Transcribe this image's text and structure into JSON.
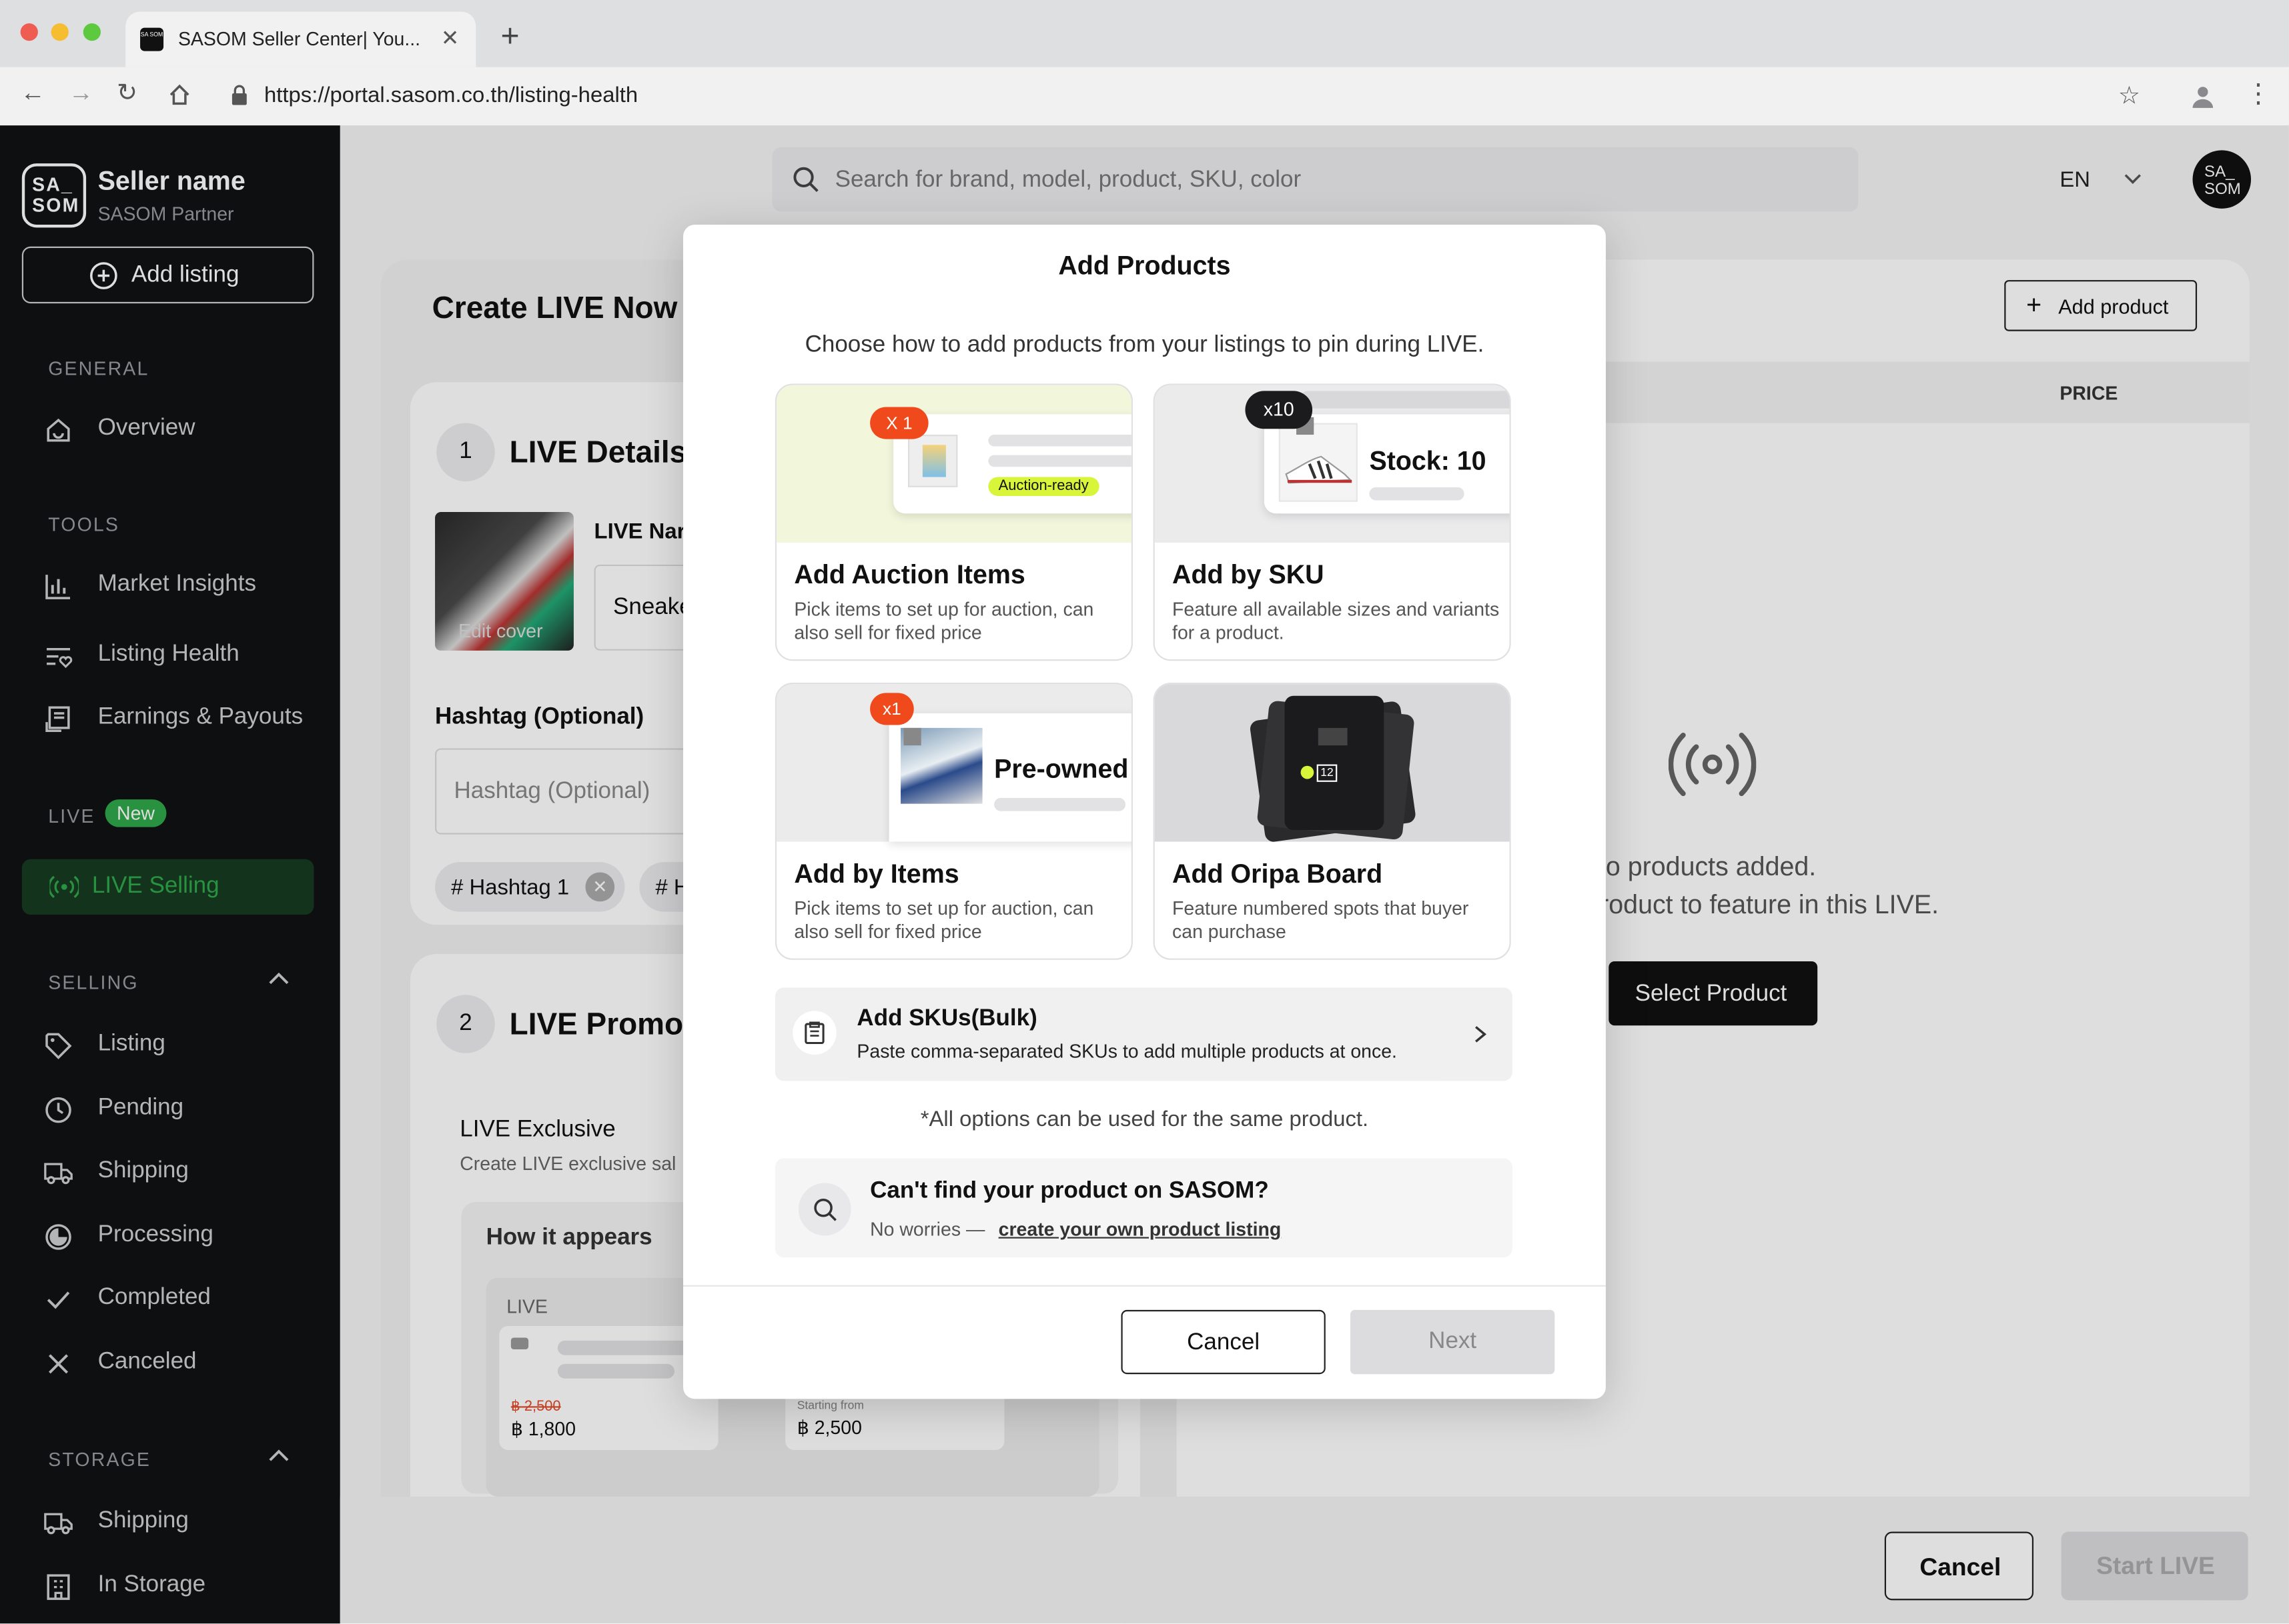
{
  "browser": {
    "tab_title": "SASOM Seller Center| You...",
    "url": "https://portal.sasom.co.th/listing-health",
    "favicon_text": "SA SOM"
  },
  "sidebar": {
    "logo_text": "SA_\nSOM",
    "seller_name": "Seller name",
    "seller_role": "SASOM Partner",
    "add_listing": "Add listing",
    "sections": {
      "general": "GENERAL",
      "tools": "TOOLS",
      "live": "LIVE",
      "live_badge": "New",
      "selling": "SELLING",
      "storage": "STORAGE"
    },
    "items": {
      "overview": "Overview",
      "market_insights": "Market Insights",
      "listing_health": "Listing Health",
      "earnings": "Earnings & Payouts",
      "live_selling": "LIVE Selling",
      "listing": "Listing",
      "pending": "Pending",
      "shipping": "Shipping",
      "processing": "Processing",
      "completed": "Completed",
      "canceled": "Canceled",
      "storage_shipping": "Shipping",
      "in_storage": "In Storage"
    }
  },
  "header": {
    "search_placeholder": "Search for brand, model, product, SKU, color",
    "language": "EN",
    "avatar_text": "SA_\nSOM"
  },
  "page": {
    "title": "Create LIVE Now",
    "step1_num": "1",
    "step1_title": "LIVE Details",
    "cover_label": "Edit cover",
    "live_name_label": "LIVE Nar",
    "live_name_value": "Sneake",
    "hashtag_label": "Hashtag (Optional)",
    "hashtag_placeholder": "Hashtag (Optional)",
    "chip1": "# Hashtag 1",
    "chip2": "# H",
    "step2_num": "2",
    "step2_title": "LIVE Promoti",
    "exclusive_title": "LIVE Exclusive",
    "exclusive_desc": "Create LIVE exclusive sal",
    "how_appears": "How it appears",
    "preview_live": "LIVE",
    "preview_old_price": "฿ 2,500",
    "preview_price1": "฿ 1,800",
    "preview_starting": "Starting from",
    "preview_price2": "฿ 2,500",
    "add_product": "Add product",
    "price_header": "PRICE",
    "empty_line1": "lo products added.",
    "empty_line2": "roduct to feature in this LIVE.",
    "select_product": "Select Product",
    "cancel": "Cancel",
    "start_live": "Start LIVE"
  },
  "modal": {
    "title": "Add Products",
    "subtitle": "Choose how to add products from your listings to pin during LIVE.",
    "options": [
      {
        "title": "Add Auction Items",
        "desc": "Pick items to set up for auction, can also sell for fixed price",
        "badge": "X 1",
        "tag": "Auction-ready"
      },
      {
        "title": "Add by SKU",
        "desc": "Feature all available sizes and variants for a product.",
        "badge": "x10",
        "stock": "Stock: 10"
      },
      {
        "title": "Add by Items",
        "desc": "Pick items to set up for auction, can also sell for fixed price",
        "badge": "x1",
        "tag": "Pre-owned"
      },
      {
        "title": "Add Oripa Board",
        "desc": "Feature numbered spots that buyer can purchase",
        "board_number": "12"
      }
    ],
    "bulk_title": "Add SKUs(Bulk)",
    "bulk_desc": "Paste comma-separated SKUs to add multiple products at once.",
    "note": "*All options can be used for the same product.",
    "cant_find_title": "Can't find your product on SASOM?",
    "cant_find_prefix": "No worries — ",
    "cant_find_link": "create your own product listing",
    "cancel": "Cancel",
    "next": "Next"
  },
  "colors": {
    "accent_green": "#2ea84a",
    "live_green": "#1e7a33",
    "badge_red": "#f04a1c",
    "auction_tag": "#d9f53a"
  }
}
